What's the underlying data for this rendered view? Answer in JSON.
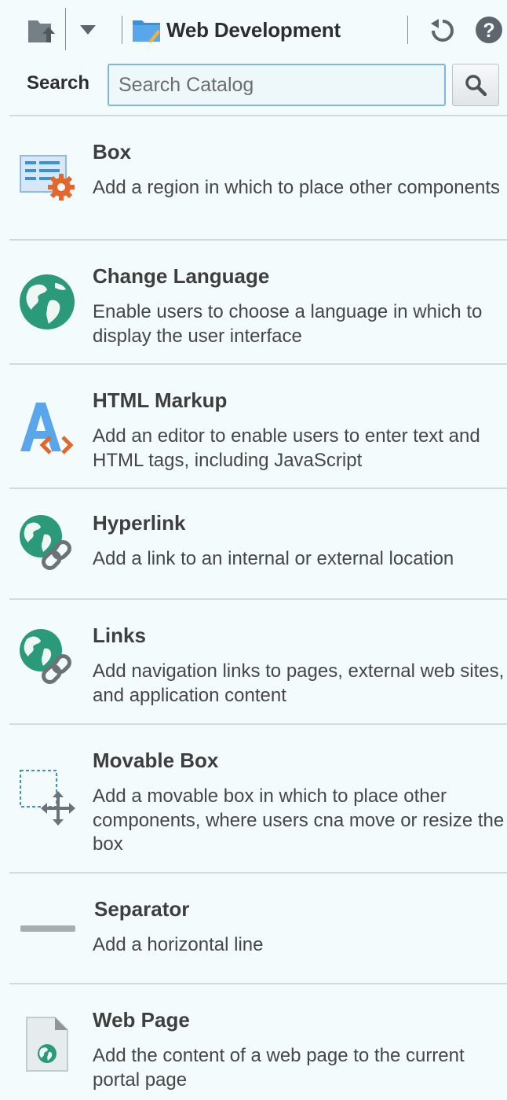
{
  "toolbar": {
    "upload_icon": "folder-upload-icon",
    "dropdown_icon": "chevron-down-icon",
    "folder_icon": "folder-icon",
    "folder_title": "Web Development",
    "refresh_icon": "refresh-icon",
    "help_icon": "help-icon"
  },
  "search": {
    "label": "Search",
    "placeholder": "Search Catalog",
    "value": "",
    "button_icon": "magnifier-icon"
  },
  "catalog": {
    "items": [
      {
        "title": "Box",
        "description": "Add a region in which to place other components",
        "icon": "box-region-icon"
      },
      {
        "title": "Change Language",
        "description": "Enable users to choose a language in which to display the user interface",
        "icon": "globe-icon"
      },
      {
        "title": "HTML Markup",
        "description": "Add an editor to enable users to enter text and HTML tags, including JavaScript",
        "icon": "html-markup-icon"
      },
      {
        "title": "Hyperlink",
        "description": "Add a link to an internal or external location",
        "icon": "globe-link-icon"
      },
      {
        "title": "Links",
        "description": "Add navigation links to pages, external web sites, and application content",
        "icon": "globe-link-icon"
      },
      {
        "title": "Movable Box",
        "description": "Add a movable box in which to place other components, where users cna move or resize the box",
        "icon": "movable-box-icon"
      },
      {
        "title": "Separator",
        "description": "Add a horizontal line",
        "icon": "separator-icon"
      },
      {
        "title": "Web Page",
        "description": "Add the content of a web page to the current portal page",
        "icon": "web-page-icon"
      }
    ]
  },
  "colors": {
    "background": "#f4fbfc",
    "globe_green": "#2a9a7a",
    "accent_orange": "#e3672b",
    "icon_blue": "#3d8fd8",
    "divider": "#d3dadd"
  }
}
